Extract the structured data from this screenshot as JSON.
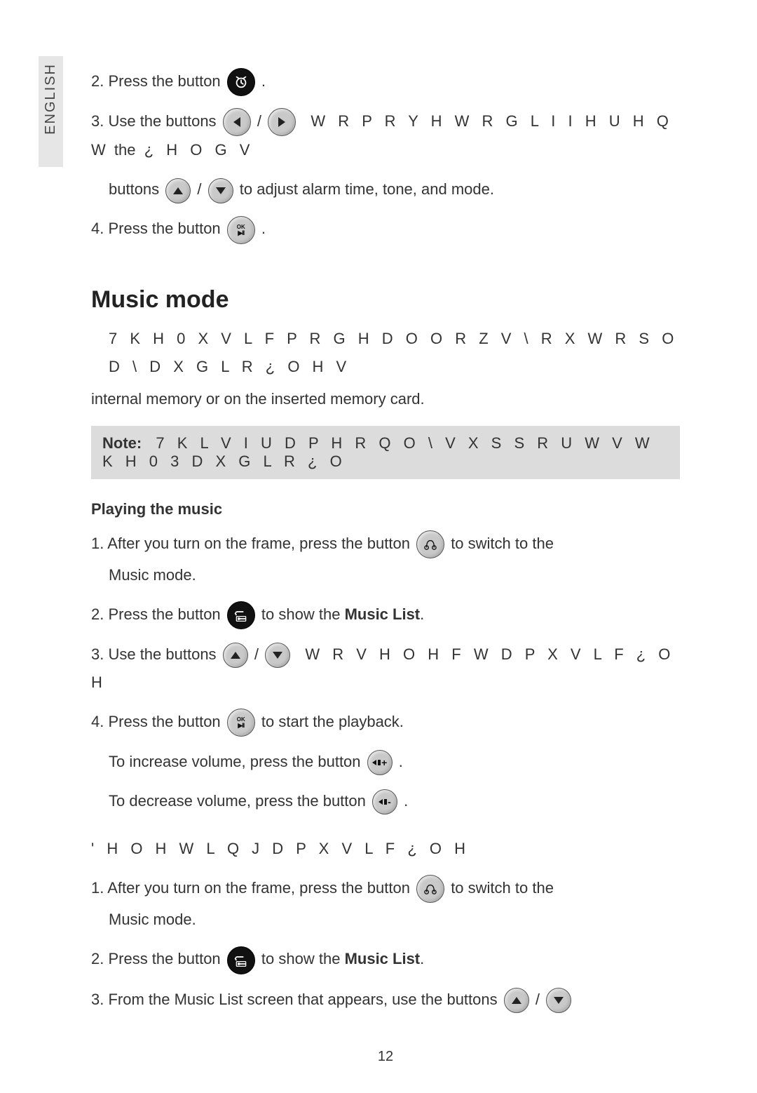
{
  "language_tab": "ENGLISH",
  "intro": {
    "step2_a": "2. Press the button",
    "step2_b": ".",
    "step3_a": "3. Use the buttons",
    "step3_sep": " / ",
    "step3_cipher": "W R   P R Y H   W R   G L I I H U H Q W",
    "step3_mid": "the",
    "step3_cipher2": "¿ H O G V",
    "step3_line2_a": "buttons",
    "step3_line2_b": " to adjust alarm time, tone, and mode.",
    "step4_a": "4. Press the button",
    "step4_b": "."
  },
  "music": {
    "heading": "Music mode",
    "desc_cipher": "7 K H   0 X V L F   P R G H   D O O R Z V   \\ R X   W R   S O D \\   D X G L R   ¿ O H V",
    "desc_line2": "internal memory or on the inserted memory card.",
    "note_label": "Note:",
    "note_cipher": "7 K L V   I U D P H   R Q O \\   V X S S R U W V   W K H   0 3     D X G L R   ¿ O"
  },
  "playing": {
    "heading": "Playing the music",
    "s1_a": "1. After you turn on the frame, press the button",
    "s1_b": "to switch to the",
    "s1_c": "Music mode.",
    "s2_a": "2. Press the button",
    "s2_b": "to show the",
    "s2_bold": "Music List",
    "s2_c": ".",
    "s3_a": "3. Use the buttons",
    "s3_sep": " / ",
    "s3_cipher": "W R   V H O H F W   D   P X V L F   ¿ O H",
    "s4_a": "4. Press the button",
    "s4_b": "to start the playback.",
    "vol_up": "To increase volume, press the button",
    "vol_down": "To decrease volume, press the button",
    "dot": "."
  },
  "deleting": {
    "heading_cipher": "' H O H W L Q J   D   P X V L F   ¿ O H",
    "s1_a": "1. After you turn on the frame, press the button",
    "s1_b": "to switch to the",
    "s1_c": "Music mode.",
    "s2_a": "2. Press the button",
    "s2_b": "to show the",
    "s2_bold": "Music List",
    "s2_c": ".",
    "s3_a": "3. From the Music List screen that appears, use the buttons",
    "s3_sep": " / "
  },
  "page_number": "12"
}
